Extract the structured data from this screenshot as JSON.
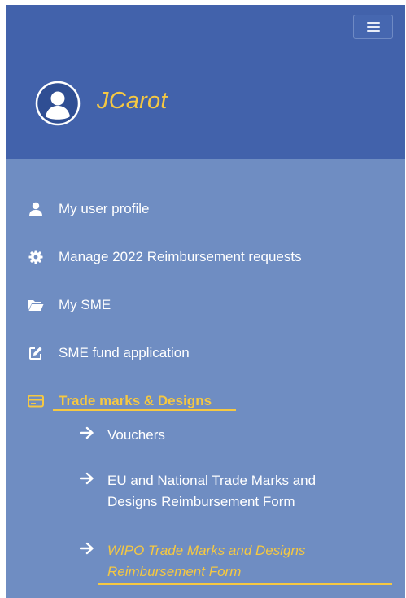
{
  "user": {
    "name": "JCarot"
  },
  "nav": {
    "items": [
      {
        "label": "My user profile",
        "icon": "user-icon"
      },
      {
        "label": "Manage 2022 Reimbursement requests",
        "icon": "gear-icon"
      },
      {
        "label": "My SME",
        "icon": "folder-open-icon"
      },
      {
        "label": "SME fund application",
        "icon": "edit-icon"
      },
      {
        "label": "Trade marks & Designs",
        "icon": "card-icon",
        "active": true
      }
    ],
    "subitems": [
      {
        "label": "Vouchers",
        "icon": "arrow-right-icon"
      },
      {
        "label_line1": "EU and National Trade Marks and",
        "label_line2": "Designs Reimbursement Form",
        "icon": "arrow-right-icon"
      },
      {
        "label_line1": "WIPO Trade Marks and Designs",
        "label_line2": "Reimbursement Form",
        "icon": "arrow-right-icon",
        "active": true
      }
    ]
  },
  "colors": {
    "header_bg": "#4262ab",
    "nav_bg": "#6f8dc2",
    "accent": "#f5c842",
    "text": "#ffffff"
  }
}
